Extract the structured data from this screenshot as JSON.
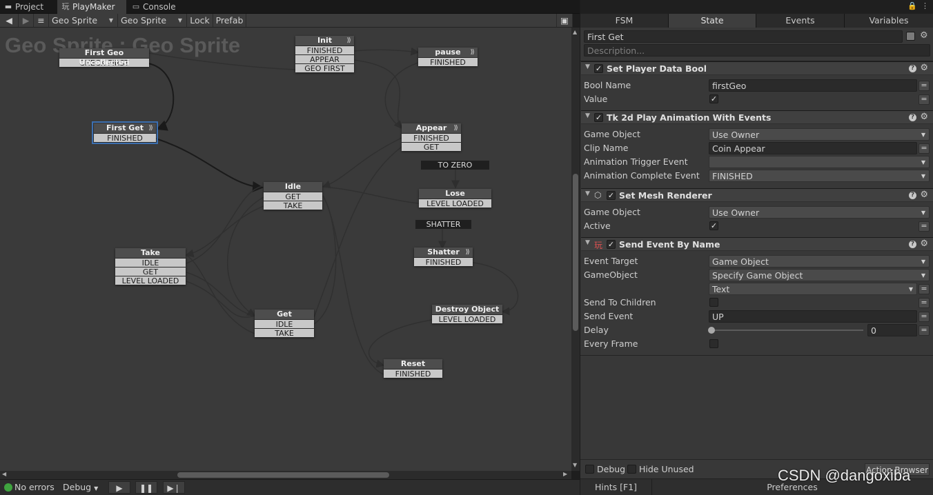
{
  "tabs": [
    {
      "label": "Project",
      "icon": "folder-icon"
    },
    {
      "label": "PlayMaker",
      "icon": "playmaker-icon"
    },
    {
      "label": "Console",
      "icon": "console-icon"
    }
  ],
  "toolbar": {
    "fsm_owner": "Geo Sprite",
    "fsm_name": "Geo Sprite",
    "lock_label": "Lock",
    "prefab_label": "Prefab"
  },
  "graph": {
    "title": "Geo Sprite : Geo Sprite",
    "nodes": {
      "first_geo_uncollected": {
        "title": "First Geo Uncollected",
        "events": [
          "CHECK FIRST"
        ]
      },
      "init": {
        "title": "Init",
        "events": [
          "FINISHED",
          "APPEAR",
          "GEO FIRST"
        ]
      },
      "pause": {
        "title": "pause",
        "events": [
          "FINISHED"
        ]
      },
      "first_get": {
        "title": "First Get",
        "events": [
          "FINISHED"
        ]
      },
      "appear": {
        "title": "Appear",
        "events": [
          "FINISHED",
          "GET"
        ]
      },
      "idle": {
        "title": "Idle",
        "events": [
          "GET",
          "TAKE"
        ]
      },
      "lose": {
        "title": "Lose",
        "events": [
          "LEVEL LOADED"
        ]
      },
      "take": {
        "title": "Take",
        "events": [
          "IDLE",
          "GET",
          "LEVEL LOADED"
        ]
      },
      "shatter": {
        "title": "Shatter",
        "events": [
          "FINISHED"
        ]
      },
      "get": {
        "title": "Get",
        "events": [
          "IDLE",
          "TAKE"
        ]
      },
      "destroy_object": {
        "title": "Destroy Object",
        "events": [
          "LEVEL LOADED"
        ]
      },
      "reset": {
        "title": "Reset",
        "events": [
          "FINISHED"
        ]
      }
    },
    "global_events": {
      "to_zero": "TO ZERO",
      "shatter": "SHATTER"
    }
  },
  "statusbar": {
    "errors": "No errors",
    "debug": "Debug"
  },
  "inspector": {
    "tabs": [
      "FSM",
      "State",
      "Events",
      "Variables"
    ],
    "active_tab": "State",
    "state_name": "First Get",
    "description_placeholder": "Description...",
    "actions": [
      {
        "title": "Set Player Data Bool",
        "fields": [
          {
            "label": "Bool Name",
            "value": "firstGeo"
          },
          {
            "label": "Value",
            "checked": true
          }
        ]
      },
      {
        "title": "Tk 2d Play Animation With Events",
        "fields": [
          {
            "label": "Game Object",
            "value": "Use Owner"
          },
          {
            "label": "Clip Name",
            "value": "Coin Appear"
          },
          {
            "label": "Animation Trigger Event",
            "value": ""
          },
          {
            "label": "Animation Complete Event",
            "value": "FINISHED"
          }
        ]
      },
      {
        "title": "Set Mesh Renderer",
        "fields": [
          {
            "label": "Game Object",
            "value": "Use Owner"
          },
          {
            "label": "Active",
            "checked": true
          }
        ]
      },
      {
        "title": "Send Event By Name",
        "fields": [
          {
            "label": "Event Target",
            "value": "Game Object"
          },
          {
            "label": "GameObject",
            "value": "Specify Game Object"
          },
          {
            "label": "",
            "value": "Text"
          },
          {
            "label": "Send To Children",
            "checked": false
          },
          {
            "label": "Send Event",
            "value": "UP"
          },
          {
            "label": "Delay",
            "value": "0",
            "slider_fraction": 0
          },
          {
            "label": "Every Frame",
            "checked": false
          }
        ]
      }
    ],
    "footer": {
      "debug_label": "Debug",
      "hide_unused_label": "Hide Unused",
      "action_browser_label": "Action Browser"
    },
    "hints_label": "Hints [F1]",
    "preferences_label": "Preferences"
  },
  "watermark": "CSDN @dangoxiba",
  "colors": {
    "selected_outline": "#3c6fb0",
    "status_ok": "#3fa43f",
    "canvas": "#3a3a3a",
    "link": "#1a1a1a"
  }
}
